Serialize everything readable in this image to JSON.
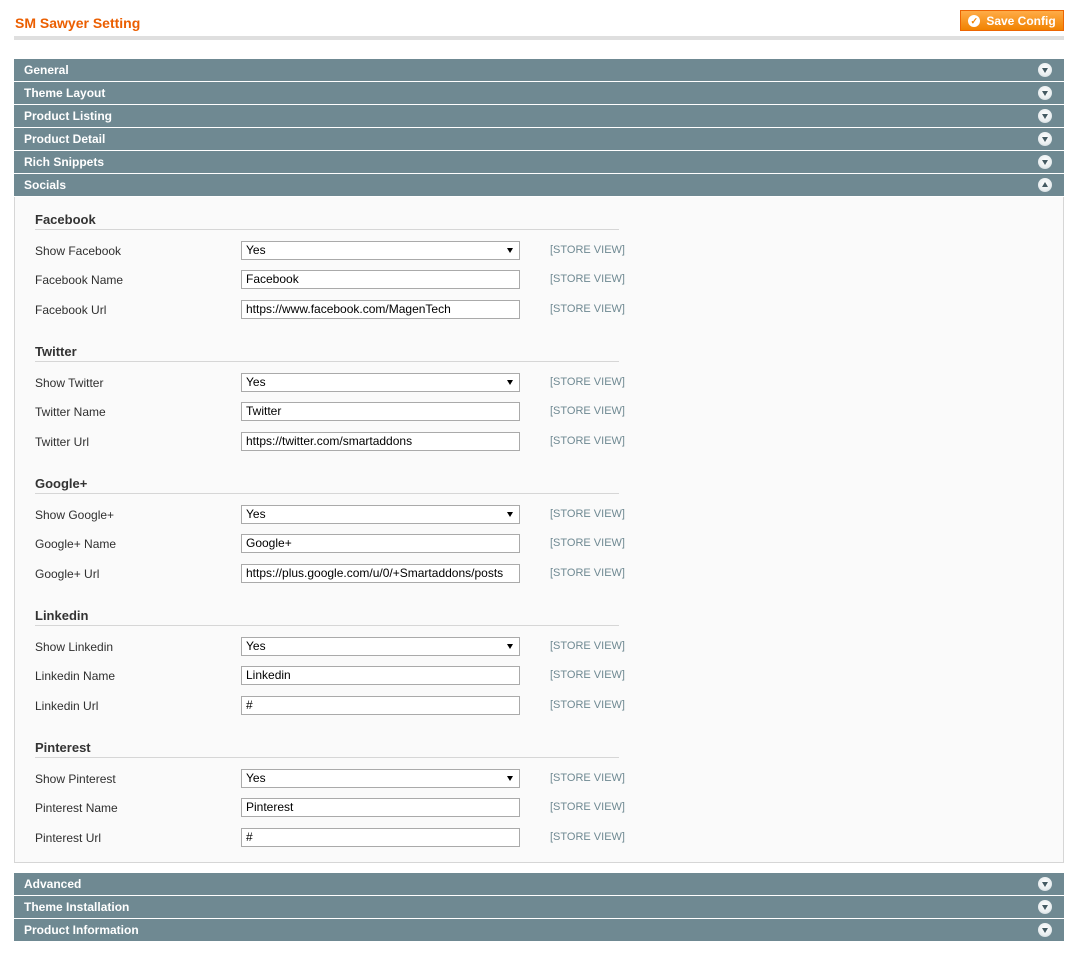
{
  "header": {
    "title": "SM Sawyer Setting",
    "save_label": "Save Config"
  },
  "sections_top": [
    "General",
    "Theme Layout",
    "Product Listing",
    "Product Detail",
    "Rich Snippets"
  ],
  "open_section": "Socials",
  "sections_bottom": [
    "Advanced",
    "Theme Installation",
    "Product Information"
  ],
  "scope_label": "[STORE VIEW]",
  "groups": [
    {
      "title": "Facebook",
      "rows": [
        {
          "label": "Show Facebook",
          "type": "select",
          "value": "Yes"
        },
        {
          "label": "Facebook Name",
          "type": "text",
          "value": "Facebook"
        },
        {
          "label": "Facebook Url",
          "type": "text",
          "value": "https://www.facebook.com/MagenTech"
        }
      ]
    },
    {
      "title": "Twitter",
      "rows": [
        {
          "label": "Show Twitter",
          "type": "select",
          "value": "Yes"
        },
        {
          "label": "Twitter Name",
          "type": "text",
          "value": "Twitter"
        },
        {
          "label": "Twitter Url",
          "type": "text",
          "value": "https://twitter.com/smartaddons"
        }
      ]
    },
    {
      "title": "Google+",
      "rows": [
        {
          "label": "Show Google+",
          "type": "select",
          "value": "Yes"
        },
        {
          "label": "Google+ Name",
          "type": "text",
          "value": "Google+"
        },
        {
          "label": "Google+ Url",
          "type": "text",
          "value": "https://plus.google.com/u/0/+Smartaddons/posts"
        }
      ]
    },
    {
      "title": "Linkedin",
      "rows": [
        {
          "label": "Show Linkedin",
          "type": "select",
          "value": "Yes"
        },
        {
          "label": "Linkedin Name",
          "type": "text",
          "value": "Linkedin"
        },
        {
          "label": "Linkedin Url",
          "type": "text",
          "value": "#"
        }
      ]
    },
    {
      "title": "Pinterest",
      "rows": [
        {
          "label": "Show Pinterest",
          "type": "select",
          "value": "Yes"
        },
        {
          "label": "Pinterest Name",
          "type": "text",
          "value": "Pinterest"
        },
        {
          "label": "Pinterest Url",
          "type": "text",
          "value": "#"
        }
      ]
    }
  ],
  "icons": {
    "save": "check-circle-icon",
    "collapsed": "chevron-down-icon",
    "expanded": "chevron-up-icon"
  },
  "colors": {
    "accent": "#eb5e00",
    "button": "#f18200",
    "section_bar": "#6f8992",
    "scope": "#6f8992"
  }
}
